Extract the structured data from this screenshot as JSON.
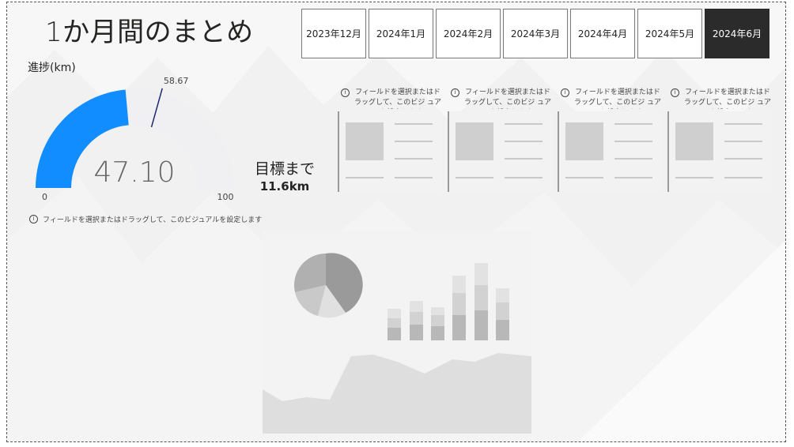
{
  "report": {
    "title": "1か月間のまとめ"
  },
  "month_slicer": {
    "items": [
      "2023年12月",
      "2024年1月",
      "2024年2月",
      "2024年3月",
      "2024年4月",
      "2024年5月",
      "2024年6月"
    ],
    "selected_index": 6
  },
  "progress_gauge": {
    "title": "進捗(km)",
    "value": 47.1,
    "value_label": "47.10",
    "min_label": "0",
    "max_label": "100",
    "target_label": "58.67",
    "min": 0,
    "max": 100,
    "target": 58.67,
    "fill_color": "#118DFF",
    "track_color": "#F0EFF1",
    "target_color": "#1B2A6B"
  },
  "remaining": {
    "label": "目標まで",
    "value": "11.6km"
  },
  "placeholder": {
    "full_text": "フィールドを選択またはドラッグして、このビジュアルを設定します",
    "card_text": "フィールドを選択またはドラッグして、このビジ ュアルを設定します",
    "info_icon_glyph": "i"
  },
  "colors": {
    "slicer_selected_bg": "#2B2B2B",
    "canvas_bg": "#F7F7F7",
    "border": "#555555"
  }
}
